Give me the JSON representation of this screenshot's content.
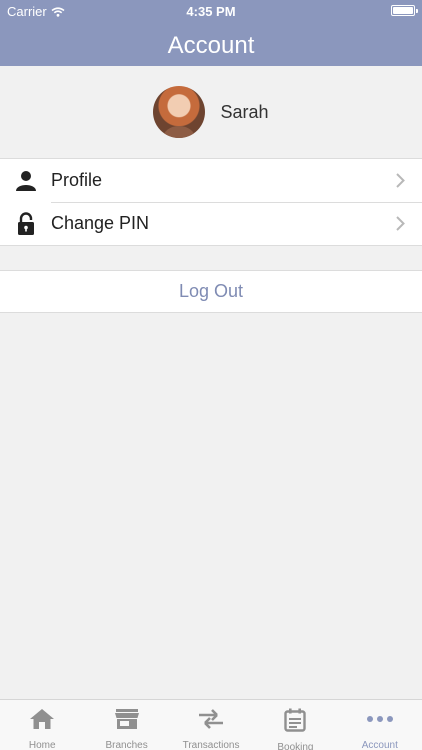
{
  "status_bar": {
    "carrier": "Carrier",
    "time": "4:35 PM"
  },
  "header": {
    "title": "Account"
  },
  "profile": {
    "name": "Sarah"
  },
  "menu": {
    "items": [
      {
        "label": "Profile",
        "icon": "person-icon"
      },
      {
        "label": "Change PIN",
        "icon": "lock-icon"
      }
    ]
  },
  "logout": {
    "label": "Log Out"
  },
  "tabs": [
    {
      "label": "Home",
      "icon": "home-icon"
    },
    {
      "label": "Branches",
      "icon": "store-icon"
    },
    {
      "label": "Transactions",
      "icon": "transfer-arrows-icon"
    },
    {
      "label": "Booking",
      "icon": "calendar-icon"
    },
    {
      "label": "Account",
      "icon": "more-dots-icon",
      "active": true
    }
  ],
  "colors": {
    "accent": "#8b97bd",
    "tab_inactive": "#909090",
    "background": "#f1f1f1"
  }
}
